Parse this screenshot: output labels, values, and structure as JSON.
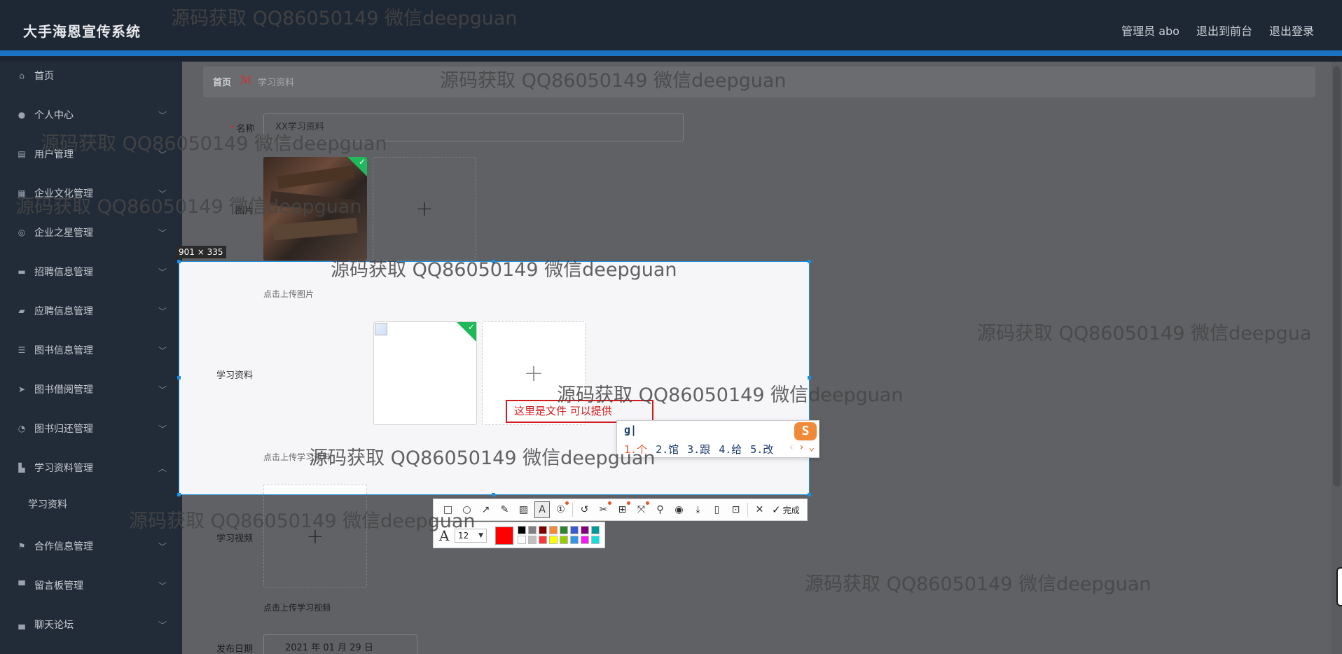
{
  "header": {
    "brand": "大手海恩宣传系统",
    "nav": [
      "管理员 abo",
      "退出到前台",
      "退出登录"
    ]
  },
  "sidebar": {
    "items": [
      {
        "label": "首页",
        "icon": "home-icon",
        "glyph": "⌂",
        "chevron": false
      },
      {
        "label": "个人中心",
        "icon": "user-icon",
        "glyph": "●",
        "chevron": true
      },
      {
        "label": "用户管理",
        "icon": "clipboard-icon",
        "glyph": "▤",
        "chevron": true
      },
      {
        "label": "企业文化管理",
        "icon": "document-icon",
        "glyph": "▦",
        "chevron": true
      },
      {
        "label": "企业之星管理",
        "icon": "dashboard-icon",
        "glyph": "◎",
        "chevron": true
      },
      {
        "label": "招聘信息管理",
        "icon": "book-icon",
        "glyph": "▬",
        "chevron": true
      },
      {
        "label": "应聘信息管理",
        "icon": "ticket-icon",
        "glyph": "▰",
        "chevron": true
      },
      {
        "label": "图书信息管理",
        "icon": "list-icon",
        "glyph": "☰",
        "chevron": true
      },
      {
        "label": "图书借阅管理",
        "icon": "send-icon",
        "glyph": "➤",
        "chevron": true
      },
      {
        "label": "图书归还管理",
        "icon": "power-icon",
        "glyph": "◔",
        "chevron": true
      },
      {
        "label": "学习资料管理",
        "icon": "chart-icon",
        "glyph": "▙",
        "chevron": true,
        "expanded": true
      },
      {
        "label": "合作信息管理",
        "icon": "flag-icon",
        "glyph": "⚑",
        "chevron": true
      },
      {
        "label": "留言板管理",
        "icon": "message-icon",
        "glyph": "▀",
        "chevron": true
      },
      {
        "label": "聊天论坛",
        "icon": "chat-icon",
        "glyph": "▄",
        "chevron": true
      }
    ],
    "subitem": "学习资料"
  },
  "breadcrumb": {
    "home": "首页",
    "separator": "ℳ",
    "current": "学习资料"
  },
  "form": {
    "name_label": "名称",
    "name_value": "XX学习资料",
    "image_label": "图片",
    "upload_image_note": "点击上传图片",
    "material_label": "学习资料",
    "upload_material_note": "点击上传学习资料",
    "video_label": "学习视频",
    "upload_video_note": "点击上传学习视频",
    "date_label": "发布日期",
    "date_value": "2021 年 01 月 29 日",
    "plus": "+"
  },
  "selection": {
    "size_badge": "901 × 335",
    "upload_image_note": "点击上传图片",
    "material_label": "学习资料",
    "upload_material_note": "点击上传学习资料"
  },
  "annotation_text": "这里是文件 可以提供",
  "ime": {
    "composition": "g|",
    "candidates": [
      "1.个",
      "2.馆",
      "3.跟",
      "4.给",
      "5.改"
    ],
    "logo": "S",
    "prev": "‹",
    "next": "›",
    "expand": "⌄"
  },
  "toolbar": {
    "tools": [
      {
        "name": "rectangle-tool-icon",
        "glyph": "□"
      },
      {
        "name": "ellipse-tool-icon",
        "glyph": "○"
      },
      {
        "name": "arrow-tool-icon",
        "glyph": "↗"
      },
      {
        "name": "pen-tool-icon",
        "glyph": "✎"
      },
      {
        "name": "mosaic-tool-icon",
        "glyph": "▨"
      },
      {
        "name": "text-tool-icon",
        "glyph": "A",
        "active": true
      },
      {
        "name": "number-tool-icon",
        "glyph": "①",
        "dot": true
      }
    ],
    "tools2": [
      {
        "name": "undo-icon",
        "glyph": "↺"
      },
      {
        "name": "scissors-icon",
        "glyph": "✂",
        "dot": true
      },
      {
        "name": "ocr-icon",
        "glyph": "⊞",
        "dot": true
      },
      {
        "name": "magic-icon",
        "glyph": "⤧",
        "dot": true
      },
      {
        "name": "pin-icon",
        "glyph": "⚲"
      },
      {
        "name": "record-icon",
        "glyph": "◉"
      },
      {
        "name": "download-icon",
        "glyph": "⤓"
      },
      {
        "name": "phone-icon",
        "glyph": "▯"
      },
      {
        "name": "bookmark-icon",
        "glyph": "⊡"
      }
    ],
    "close": "✕",
    "done_check": "✓",
    "done_label": "完成"
  },
  "text_options": {
    "font_icon": "A",
    "font_size": "12",
    "current_color": "#ff0000",
    "swatches": [
      "#000000",
      "#808080",
      "#800000",
      "#f7883a",
      "#308430",
      "#385ad3",
      "#800080",
      "#009999",
      "#ffffff",
      "#c0c0c0",
      "#fb3838",
      "#ffff00",
      "#99cc00",
      "#3894e4",
      "#f31bf3",
      "#16dcdc"
    ]
  },
  "watermarks": [
    "源码获取 QQ86050149 微信deepguan",
    "源码获取 QQ86050149 微信deepguan",
    "源码获取 QQ86050149 微信deepguan",
    "源码获取 QQ86050149 微信deepguan",
    "源码获取 QQ86050149 微信deepguan",
    "源码获取 QQ86050149 微信deepguan",
    "源码获取 QQ86050149 微信deepguan",
    "源码获取 QQ86050149 微信deepguan",
    "源码获取 QQ86050149 微信deepguan",
    "源码获取 QQ86050149 微信deepgua"
  ]
}
